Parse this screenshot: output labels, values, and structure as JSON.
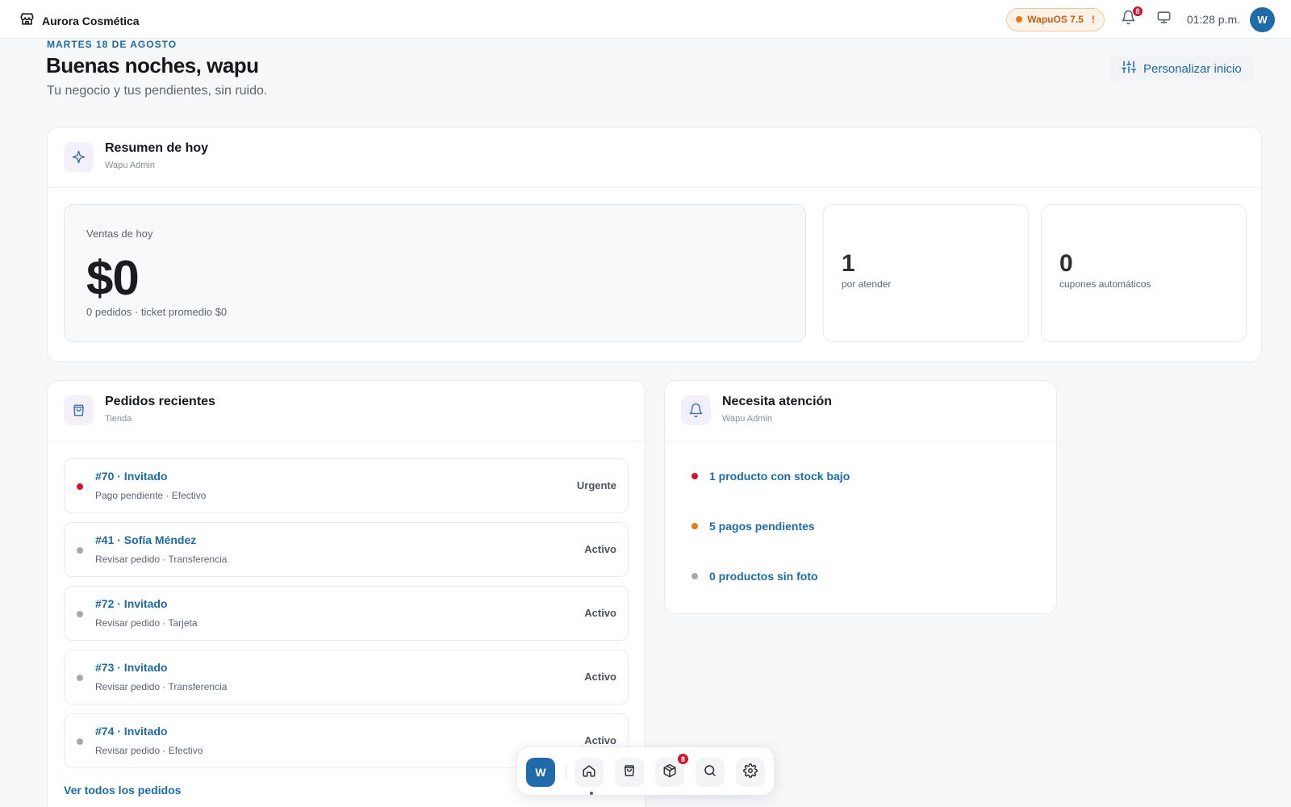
{
  "header": {
    "store_name": "Aurora Cosmética",
    "os_version": "WapuOS 7.5",
    "os_warning": "!",
    "notification_count": "8",
    "time": "01:28 p.m.",
    "avatar_initial": "W"
  },
  "hero": {
    "date": "MARTES 18 DE AGOSTO",
    "greeting": "Buenas noches, wapu",
    "subtitle": "Tu negocio y tus pendientes, sin ruido.",
    "customize_label": "Personalizar inicio"
  },
  "summary": {
    "title": "Resumen de hoy",
    "subtitle": "Wapu Admin",
    "sales_label": "Ventas de hoy",
    "sales_value": "$0",
    "sales_meta": "0 pedidos · ticket promedio $0",
    "stats": [
      {
        "value": "1",
        "label": "por atender"
      },
      {
        "value": "0",
        "label": "cupones automáticos"
      }
    ]
  },
  "orders": {
    "title": "Pedidos recientes",
    "subtitle": "Tienda",
    "items": [
      {
        "title": "#70 · Invitado",
        "meta": "Pago pendiente · Efectivo",
        "status": "Urgente"
      },
      {
        "title": "#41 · Sofía Méndez",
        "meta": "Revisar pedido · Transferencia",
        "status": "Activo"
      },
      {
        "title": "#72 · Invitado",
        "meta": "Revisar pedido · Tarjeta",
        "status": "Activo"
      },
      {
        "title": "#73 · Invitado",
        "meta": "Revisar pedido · Transferencia",
        "status": "Activo"
      },
      {
        "title": "#74 · Invitado",
        "meta": "Revisar pedido · Efectivo",
        "status": "Activo"
      }
    ],
    "see_all": "Ver todos los pedidos"
  },
  "attention": {
    "title": "Necesita atención",
    "subtitle": "Wapu Admin",
    "items": [
      {
        "label": "1 producto con stock bajo",
        "color": "#d3142c"
      },
      {
        "label": "5 pagos pendientes",
        "color": "#ea7a12"
      },
      {
        "label": "0 productos sin foto",
        "color": "#a4a9b1"
      }
    ]
  },
  "dock": {
    "home_initial": "W",
    "orders_badge": "8"
  },
  "colors": {
    "accent": "#1d6aa6",
    "urgent": "#d3142c",
    "warning": "#ea7a12"
  }
}
